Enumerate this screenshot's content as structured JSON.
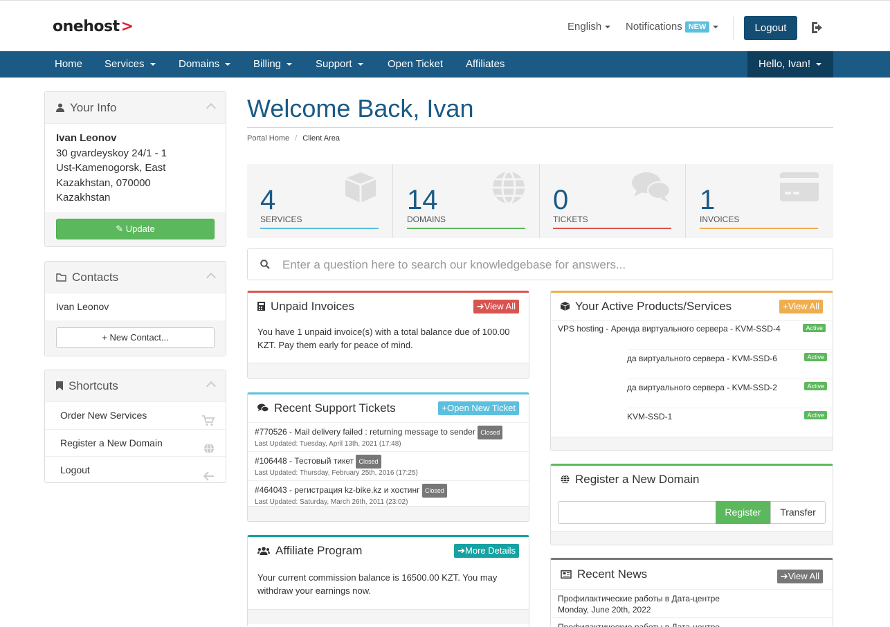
{
  "header": {
    "logo": "onehost",
    "language": "English",
    "notifications": "Notifications",
    "notifications_badge": "NEW",
    "logout": "Logout"
  },
  "nav": {
    "items": [
      "Home",
      "Services",
      "Domains",
      "Billing",
      "Support",
      "Open Ticket",
      "Affiliates"
    ],
    "user": "Hello, Ivan!"
  },
  "sidebar": {
    "info": {
      "title": "Your Info",
      "name": "Ivan Leonov",
      "address1": "30 gvardeyskoy 24/1 - 1",
      "address2": "Ust-Kamenogorsk, East",
      "address3": "Kazakhstan, 070000",
      "country": "Kazakhstan",
      "update": "Update"
    },
    "contacts": {
      "title": "Contacts",
      "contact": "Ivan Leonov",
      "new_contact": "New Contact..."
    },
    "shortcuts": {
      "title": "Shortcuts",
      "items": [
        "Order New Services",
        "Register a New Domain",
        "Logout"
      ]
    }
  },
  "main": {
    "title": "Welcome Back, Ivan",
    "breadcrumb": [
      "Portal Home",
      "Client Area"
    ],
    "tiles": [
      {
        "value": "4",
        "label": "SERVICES",
        "color": "#5bc0de"
      },
      {
        "value": "14",
        "label": "DOMAINS",
        "color": "#5cb85c"
      },
      {
        "value": "0",
        "label": "TICKETS",
        "color": "#d9534f"
      },
      {
        "value": "1",
        "label": "INVOICES",
        "color": "#f0ad4e"
      }
    ],
    "search_placeholder": "Enter a question here to search our knowledgebase for answers..."
  },
  "invoices": {
    "title": "Unpaid Invoices",
    "view_all": "View All",
    "text": "You have 1 unpaid invoice(s) with a total balance due of 100.00 KZT. Pay them early for peace of mind."
  },
  "tickets": {
    "title": "Recent Support Tickets",
    "open_new": "Open New Ticket",
    "items": [
      {
        "subject": "#770526 - Mail delivery failed : returning message to sender",
        "status": "Closed",
        "updated": "Last Updated: Tuesday, April 13th, 2021 (17:48)"
      },
      {
        "subject": "#106448 - Тестовый тикет",
        "status": "Closed",
        "updated": "Last Updated: Thursday, February 25th, 2016 (17:25)"
      },
      {
        "subject": "#464043 - регистрация kz-bike.kz и хостинг",
        "status": "Closed",
        "updated": "Last Updated: Saturday, March 26th, 2011 (23:02)"
      }
    ]
  },
  "affiliate": {
    "title": "Affiliate Program",
    "more": "More Details",
    "text": "Your current commission balance is 16500.00 KZT. You may withdraw your earnings now."
  },
  "products": {
    "title": "Your Active Products/Services",
    "view_all": "View All",
    "items": [
      {
        "name": "VPS hosting - Аренда виртуального сервера - KVM-SSD-4",
        "status": "Active"
      },
      {
        "name": "да виртуального сервера - KVM-SSD-6",
        "status": "Active"
      },
      {
        "name": "да виртуального сервера - KVM-SSD-2",
        "status": "Active"
      },
      {
        "name": "KVM-SSD-1",
        "status": "Active"
      }
    ]
  },
  "domain": {
    "title": "Register a New Domain",
    "register": "Register",
    "transfer": "Transfer"
  },
  "news": {
    "title": "Recent News",
    "view_all": "View All",
    "items": [
      {
        "title": "Профилактические работы в Дата-центре",
        "date": "Monday, June 20th, 2022"
      },
      {
        "title": "Профилактические работы в Дата-центре",
        "date": ""
      }
    ]
  }
}
